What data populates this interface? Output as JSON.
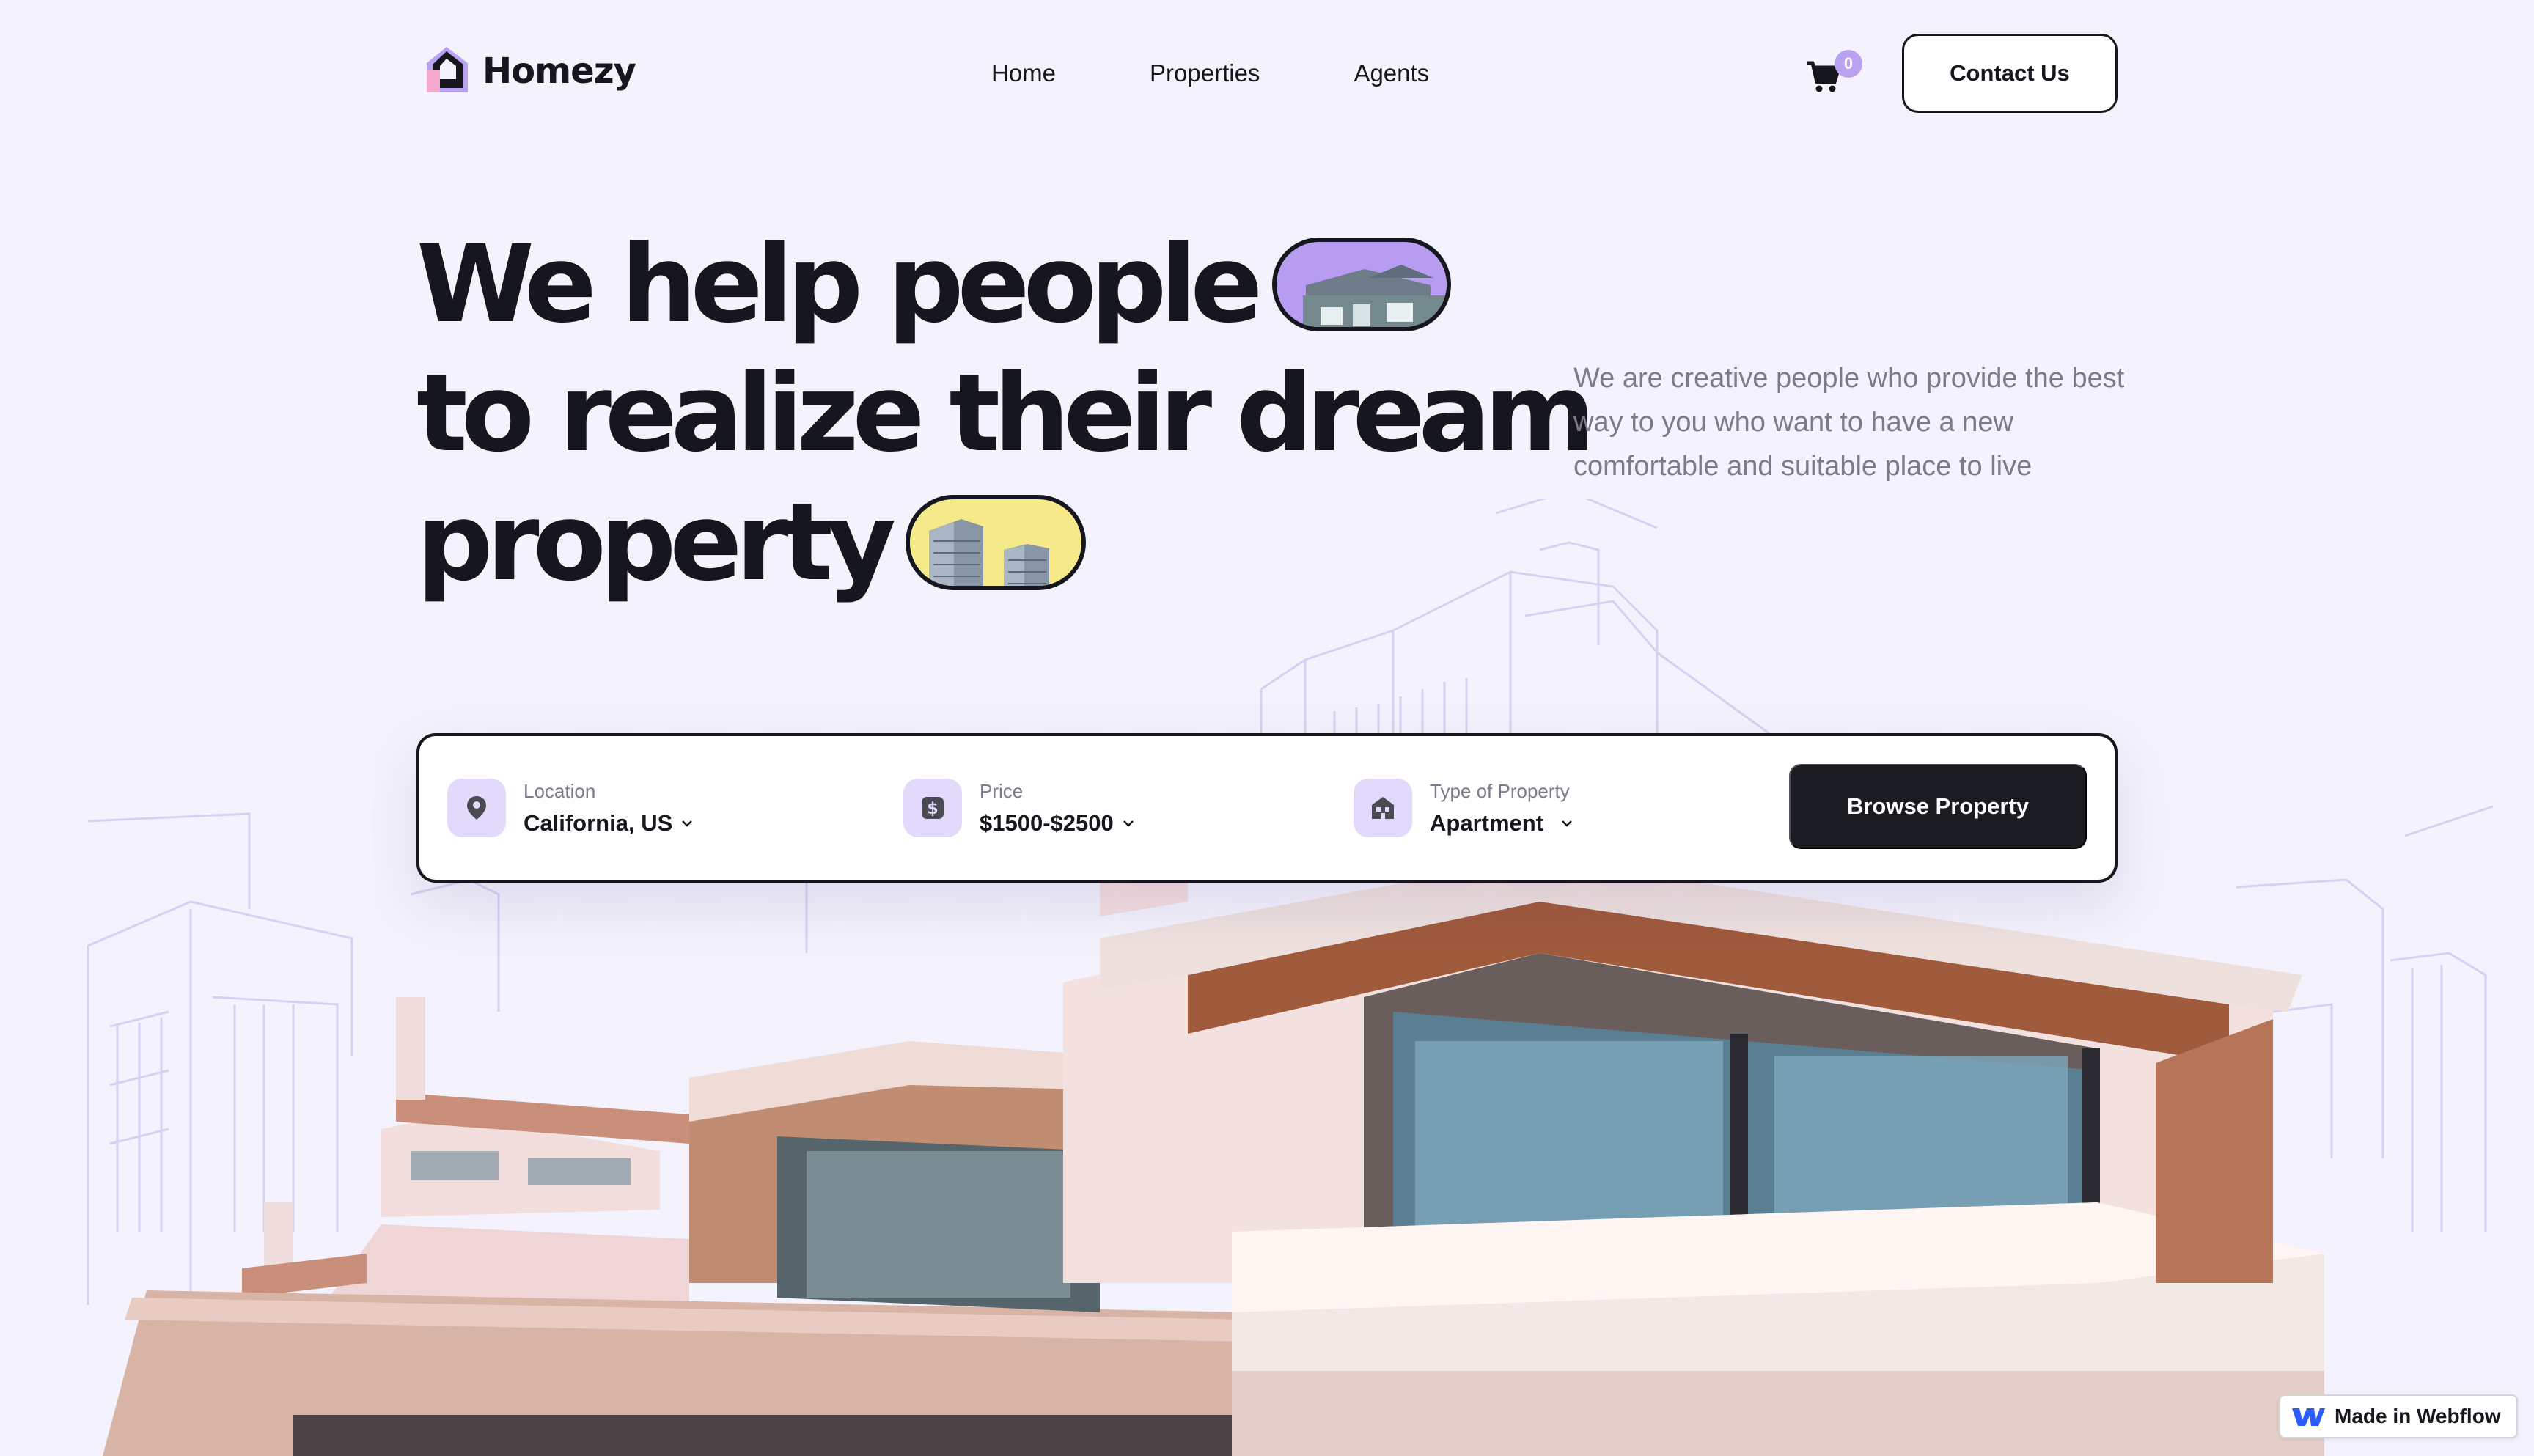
{
  "brand": {
    "name": "Homezy"
  },
  "nav": {
    "items": [
      "Home",
      "Properties",
      "Agents"
    ]
  },
  "cart": {
    "count": "0"
  },
  "header": {
    "contact_label": "Contact Us"
  },
  "hero": {
    "line1": "We help people",
    "line2": "to realize their dream",
    "line3": "property",
    "description": "We are creative people who provide the best way to you who want to have a new comfortable and suitable place to live"
  },
  "search": {
    "location": {
      "label": "Location",
      "value": "California, US"
    },
    "price": {
      "label": "Price",
      "value": "$1500-$2500"
    },
    "type": {
      "label": "Type of Property",
      "value": "Apartment"
    },
    "button_label": "Browse Property"
  },
  "badge": {
    "label": "Made in Webflow"
  },
  "colors": {
    "background": "#f4f2fc",
    "accent": "#b9a2f2",
    "dark": "#16161e",
    "icon_bg": "#e2d9fb",
    "pill_yellow": "#f5e98a"
  }
}
